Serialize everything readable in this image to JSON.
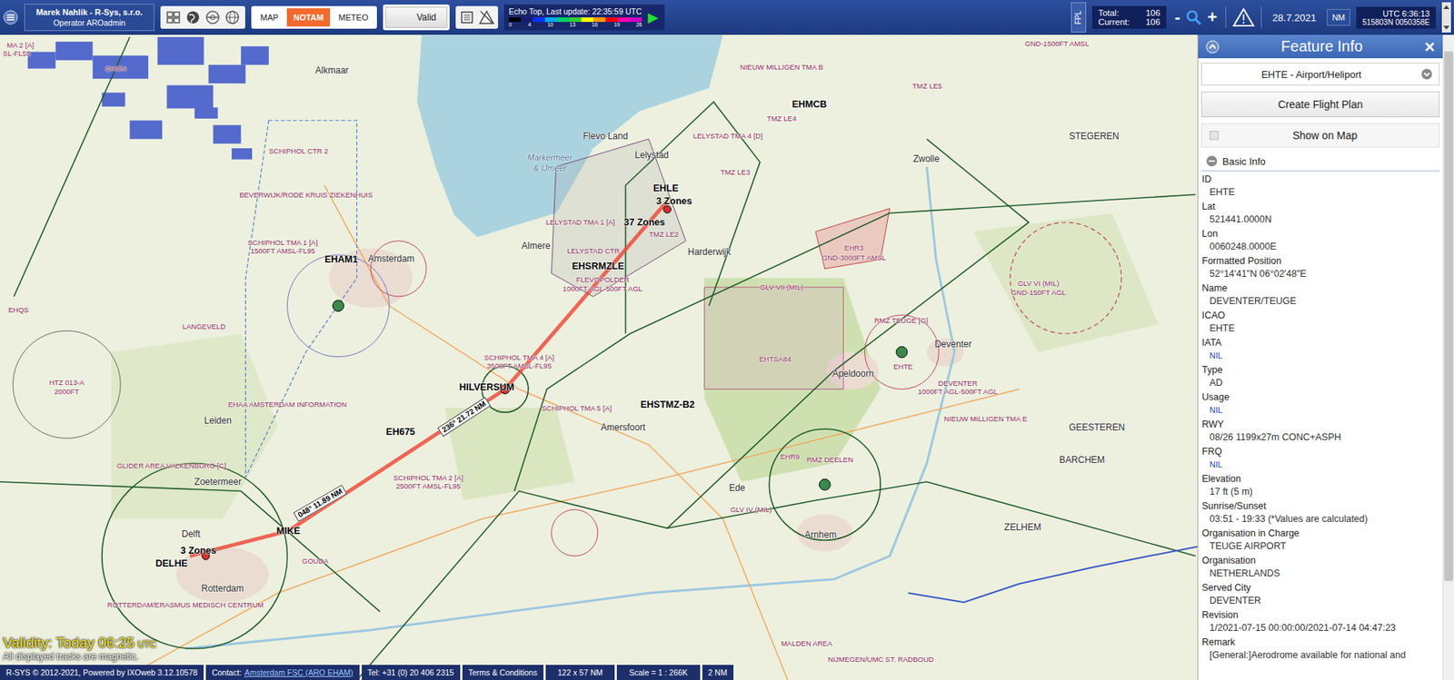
{
  "topbar": {
    "company": "Marek Nahlik - R-Sys, s.r.o.",
    "operator": "Operator AROadmin",
    "modes": [
      {
        "label": "MAP",
        "selected": false
      },
      {
        "label": "NOTAM",
        "selected": true
      },
      {
        "label": "METEO",
        "selected": false
      }
    ],
    "valid": "Valid",
    "echo_top": {
      "title": "Echo Top, Last update: 22:35:59 UTC",
      "colors": [
        "#000000",
        "#1a1a6e",
        "#0033ff",
        "#00aaff",
        "#00cc66",
        "#33cc33",
        "#ffff00",
        "#ff9900",
        "#ff0000",
        "#ff00aa",
        "#cc00cc"
      ],
      "scale": [
        "0",
        "4",
        "10",
        "13",
        "16",
        "19",
        "26"
      ],
      "play": "▶"
    },
    "fpl": "FPL",
    "total_label": "Total:",
    "total": "106",
    "current_label": "Current:",
    "current": "106",
    "zoom_out": "-",
    "zoom_in": "+",
    "date": "28.7.2021",
    "units": "NM",
    "utc": "UTC 6:36:13",
    "position": "515803N 0050358E"
  },
  "map": {
    "labels": [
      {
        "text": "MA 2 [A]",
        "kind": "airspace"
      },
      {
        "text": "SL-FL55",
        "kind": "airspace"
      },
      {
        "text": "EHON",
        "kind": "airspace"
      },
      {
        "text": "Alkmaar",
        "kind": "place"
      },
      {
        "text": "SCHIPHOL CTR 2",
        "kind": "airspace"
      },
      {
        "text": "BEVERWIJK/RODE KRUIS ZIEKENHUIS",
        "kind": "airspace"
      },
      {
        "text": "Markermeer",
        "kind": "water"
      },
      {
        "text": "& IJmeer",
        "kind": "water"
      },
      {
        "text": "Flevo Land",
        "kind": "place"
      },
      {
        "text": "Lelystad",
        "kind": "place"
      },
      {
        "text": "LELYSTAD TMA 4 [D]",
        "kind": "airspace"
      },
      {
        "text": "TMZ LE3",
        "kind": "airspace"
      },
      {
        "text": "NIEUW MILLIGEN TMA B",
        "kind": "airspace"
      },
      {
        "text": "EHMCB",
        "kind": "code"
      },
      {
        "text": "TMZ LE4",
        "kind": "airspace"
      },
      {
        "text": "TMZ LE5",
        "kind": "airspace"
      },
      {
        "text": "GND-1500FT AMSL",
        "kind": "airspace"
      },
      {
        "text": "Zwolle",
        "kind": "place"
      },
      {
        "text": "STEGEREN",
        "kind": "place"
      },
      {
        "text": "EHLE",
        "kind": "code"
      },
      {
        "text": "3 Zones",
        "kind": "code"
      },
      {
        "text": "37 Zones",
        "kind": "code"
      },
      {
        "text": "LELYSTAD TMA 1 [A]",
        "kind": "airspace"
      },
      {
        "text": "TMZ LE2",
        "kind": "airspace"
      },
      {
        "text": "Almere",
        "kind": "place"
      },
      {
        "text": "LELYSTAD CTR",
        "kind": "airspace"
      },
      {
        "text": "EHSRMZLE",
        "kind": "code"
      },
      {
        "text": "FLEVOPOLDER",
        "kind": "airspace"
      },
      {
        "text": "1000FT AGL-500FT AGL",
        "kind": "airspace"
      },
      {
        "text": "Harderwijk",
        "kind": "place"
      },
      {
        "text": "EHR3",
        "kind": "airspace"
      },
      {
        "text": "GND-3000FT AMSL",
        "kind": "airspace"
      },
      {
        "text": "GLV VI (MIL)",
        "kind": "airspace"
      },
      {
        "text": "GND-150FT AGL",
        "kind": "airspace"
      },
      {
        "text": "EHAM1",
        "kind": "code"
      },
      {
        "text": "Amsterdam",
        "kind": "place"
      },
      {
        "text": "SCHIPHOL TMA 1 [A]",
        "kind": "airspace"
      },
      {
        "text": "1500FT AMSL-FL95",
        "kind": "airspace"
      },
      {
        "text": "LANGEVELD",
        "kind": "airspace"
      },
      {
        "text": "EHQS",
        "kind": "airspace"
      },
      {
        "text": "HTZ 013-A",
        "kind": "airspace"
      },
      {
        "text": "2000FT",
        "kind": "airspace"
      },
      {
        "text": "SCHIPHOL TMA 4 [A]",
        "kind": "airspace"
      },
      {
        "text": "3500FT AMSL-FL95",
        "kind": "airspace"
      },
      {
        "text": "HILVERSUM",
        "kind": "code"
      },
      {
        "text": "EH675",
        "kind": "code"
      },
      {
        "text": "SCHIPHOL TMA 5 [A]",
        "kind": "airspace"
      },
      {
        "text": "Amersfoort",
        "kind": "place"
      },
      {
        "text": "EHSTMZ-B2",
        "kind": "code"
      },
      {
        "text": "GLV VII (MIL)",
        "kind": "airspace"
      },
      {
        "text": "EHTSA84",
        "kind": "airspace"
      },
      {
        "text": "RMZ TEUGE [G]",
        "kind": "airspace"
      },
      {
        "text": "Deventer",
        "kind": "place"
      },
      {
        "text": "EHTE",
        "kind": "airspace"
      },
      {
        "text": "Apeldoorn",
        "kind": "place"
      },
      {
        "text": "DEVENTER",
        "kind": "airspace"
      },
      {
        "text": "1000FT AGL-500FT AGL",
        "kind": "airspace"
      },
      {
        "text": "EHR9",
        "kind": "airspace"
      },
      {
        "text": "RMZ DEELEN",
        "kind": "airspace"
      },
      {
        "text": "NIEUW MILLIGEN TMA E",
        "kind": "airspace"
      },
      {
        "text": "GEESTEREN",
        "kind": "place"
      },
      {
        "text": "BARCHEM",
        "kind": "place"
      },
      {
        "text": "Ede",
        "kind": "place"
      },
      {
        "text": "GLV IV (MIL)",
        "kind": "airspace"
      },
      {
        "text": "Arnhem",
        "kind": "place"
      },
      {
        "text": "ZELHEM",
        "kind": "place"
      },
      {
        "text": "EHAA AMSTERDAM INFORMATION",
        "kind": "airspace"
      },
      {
        "text": "Leiden",
        "kind": "place"
      },
      {
        "text": "GLIDER AREA VALKENBURG [C]",
        "kind": "airspace"
      },
      {
        "text": "Zoetermeer",
        "kind": "place"
      },
      {
        "text": "SCHIPHOL TMA 2 [A]",
        "kind": "airspace"
      },
      {
        "text": "2500FT AMSL-FL95",
        "kind": "airspace"
      },
      {
        "text": "Delft",
        "kind": "place"
      },
      {
        "text": "3 Zones",
        "kind": "code"
      },
      {
        "text": "DELHE",
        "kind": "code"
      },
      {
        "text": "MIKE",
        "kind": "code"
      },
      {
        "text": "GOUDA",
        "kind": "airspace"
      },
      {
        "text": "Rotterdam",
        "kind": "place"
      },
      {
        "text": "ROTTERDAM/ERASMUS MEDISCH CENTRUM",
        "kind": "airspace"
      },
      {
        "text": "MALDEN AREA",
        "kind": "airspace"
      },
      {
        "text": "NIJMEGEN/UMC ST. RADBOUD",
        "kind": "airspace"
      },
      {
        "text": "048° 11.89 NM",
        "kind": "route"
      },
      {
        "text": "236° 21.72 NM",
        "kind": "route"
      }
    ],
    "validity": "Validity: Today 06:25",
    "validity_unit": "UTC",
    "tracks_note": "All displayed tracks are magnetic."
  },
  "status_bar": {
    "copyright": "R-SYS © 2012-2021, Powered by IXOweb 3.12.10578",
    "contact_label": "Contact:",
    "contact_link": "Amsterdam FSC (ARO EHAM)",
    "tel": "Tel: +31 (0) 20 406 2315",
    "terms": "Terms & Conditions",
    "extent": "122 x 57 NM",
    "scale": "Scale = 1 : 266K",
    "distance": "2 NM"
  },
  "panel": {
    "title": "Feature Info",
    "feature": "EHTE - Airport/Heliport",
    "create_button": "Create Flight Plan",
    "show_on_map": {
      "label": "Show on Map",
      "checked": false
    },
    "section": "Basic Info",
    "fields": [
      {
        "label": "ID",
        "value": "EHTE",
        "kind": "text"
      },
      {
        "label": "Lat",
        "value": "521441.0000N",
        "kind": "text"
      },
      {
        "label": "Lon",
        "value": "0060248.0000E",
        "kind": "text"
      },
      {
        "label": "Formatted Position",
        "value": "52°14'41\"N 06°02'48\"E",
        "kind": "text"
      },
      {
        "label": "Name",
        "value": "DEVENTER/TEUGE",
        "kind": "text"
      },
      {
        "label": "ICAO",
        "value": "EHTE",
        "kind": "text"
      },
      {
        "label": "IATA",
        "value": "NIL",
        "kind": "nil"
      },
      {
        "label": "Type",
        "value": "AD",
        "kind": "text"
      },
      {
        "label": "Usage",
        "value": "NIL",
        "kind": "nil"
      },
      {
        "label": "RWY",
        "value": "08/26 1199x27m CONC+ASPH",
        "kind": "text"
      },
      {
        "label": "FRQ",
        "value": "NIL",
        "kind": "nil"
      },
      {
        "label": "Elevation",
        "value": "17 ft (5 m)",
        "kind": "text"
      },
      {
        "label": "Sunrise/Sunset",
        "value": "03:51 - 19:33 (*Values are calculated)",
        "kind": "text"
      },
      {
        "label": "Organisation in Charge",
        "value": "TEUGE AIRPORT",
        "kind": "text"
      },
      {
        "label": "Organisation",
        "value": "NETHERLANDS",
        "kind": "text"
      },
      {
        "label": "Served City",
        "value": "DEVENTER",
        "kind": "text"
      },
      {
        "label": "Revision",
        "value": "1/2021-07-15 00:00:00/2021-07-14 04:47:23",
        "kind": "text"
      },
      {
        "label": "Remark",
        "value": "[General:]Aerodrome available for national and",
        "kind": "text"
      }
    ]
  }
}
